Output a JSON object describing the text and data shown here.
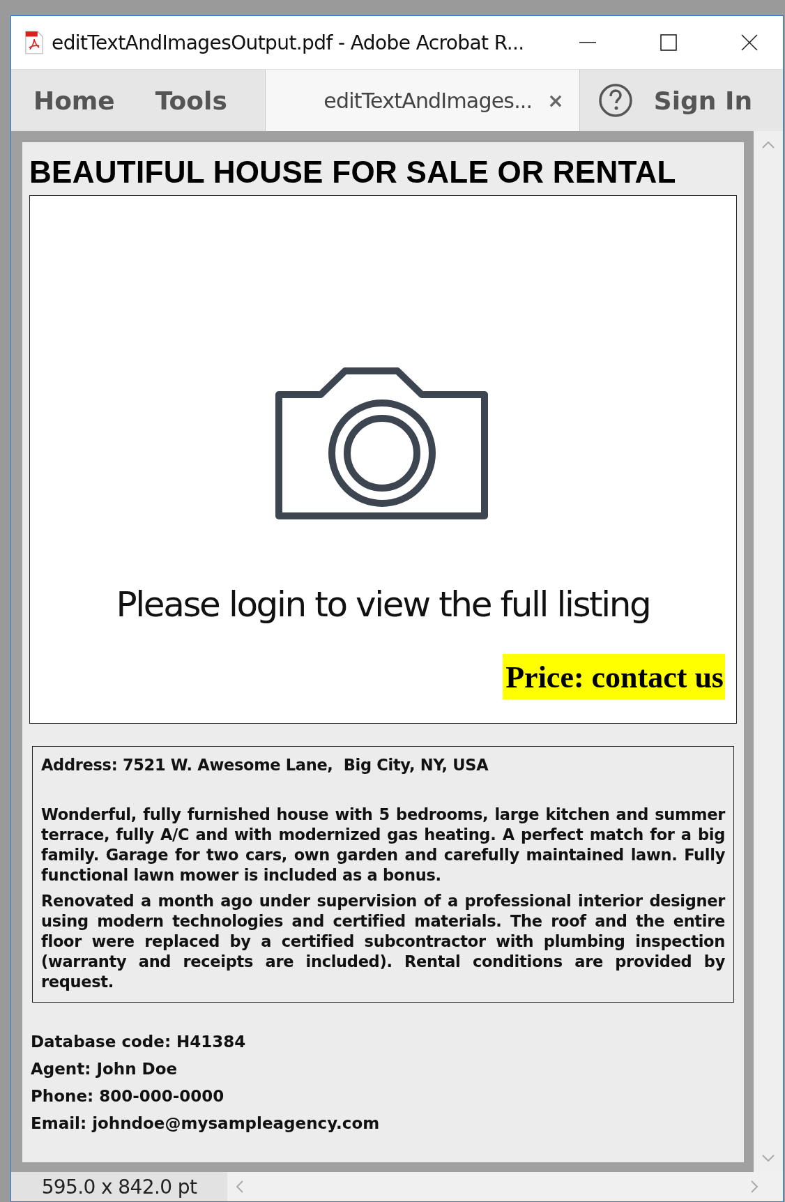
{
  "window": {
    "title": "editTextAndImagesOutput.pdf - Adobe Acrobat R..."
  },
  "tabs": [
    {
      "label": "Home",
      "kind": "nav"
    },
    {
      "label": "Tools",
      "kind": "nav"
    },
    {
      "label": "editTextAndImages...",
      "kind": "document",
      "close": "×"
    }
  ],
  "sign_in": "Sign In",
  "document": {
    "heading": "BEAUTIFUL HOUSE FOR SALE OR RENTAL",
    "image_caption": "Please login to view the full listing",
    "price": "Price: contact us",
    "address": "Address: 7521 W. Awesome Lane,  Big City, NY, USA",
    "paragraphs": [
      "Wonderful, fully furnished house with 5 bedrooms, large kitchen and summer terrace, fully A/C and with modernized gas heating. A perfect match for a big family. Garage for two cars, own garden and carefully maintained lawn. Fully functional lawn mower is included as a bonus.",
      "Renovated a month ago under supervision of a professional interior designer using modern technologies and certified materials. The roof and the entire floor were replaced by a certified subcontractor with plumbing inspection (warranty and receipts are included). Rental conditions are provided by request."
    ],
    "details": [
      "Database code: H41384",
      "Agent: John Doe",
      "Phone: 800-000-0000",
      "Email: johndoe@mysampleagency.com"
    ]
  },
  "status_bar": {
    "page_size": "595.0 x 842.0 pt"
  }
}
